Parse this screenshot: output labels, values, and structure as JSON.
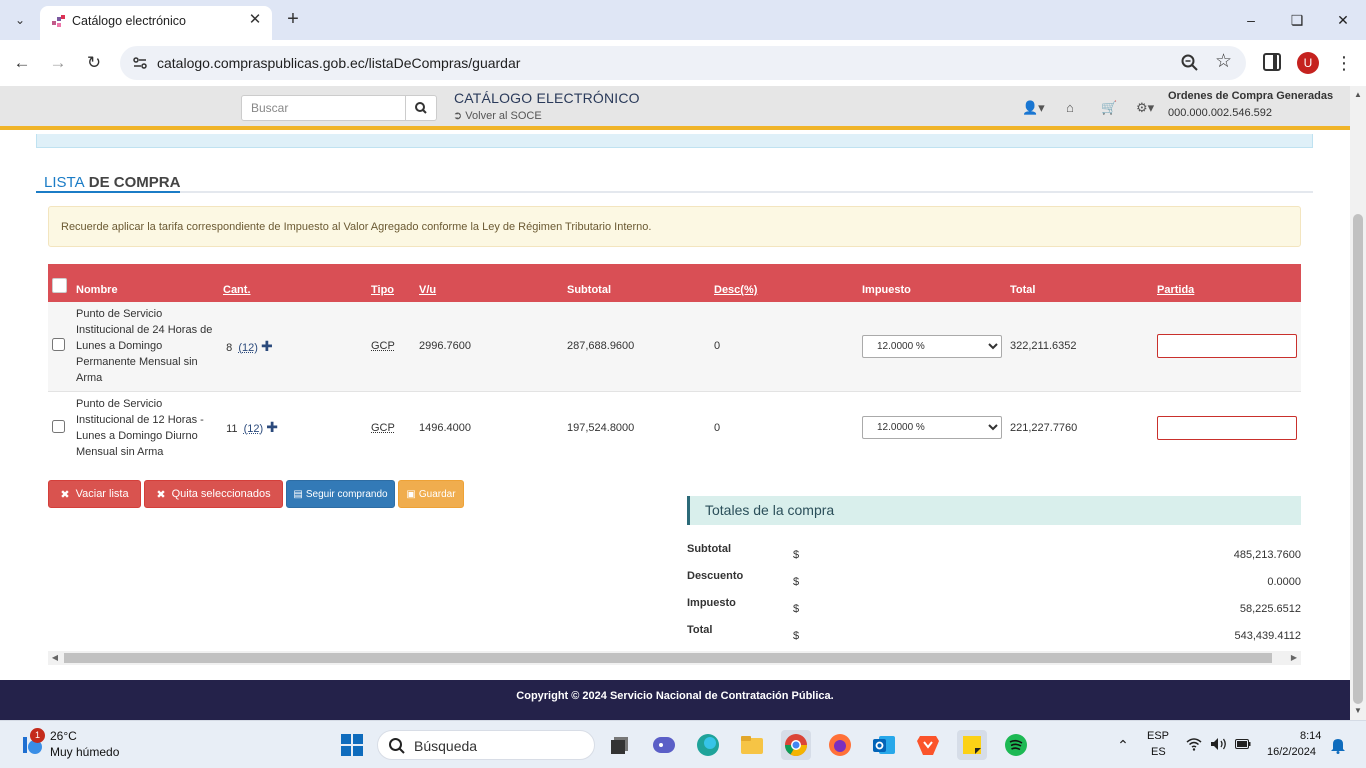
{
  "browser": {
    "tab_title": "Catálogo electrónico",
    "url": "catalogo.compraspublicas.gob.ec/listaDeCompras/guardar",
    "profile_initial": "U"
  },
  "header": {
    "search_placeholder": "Buscar",
    "brand_title": "CATÁLOGO ELECTRÓNICO",
    "back_link": "Volver al SOCE",
    "orders_title": "Ordenes de Compra Generadas",
    "orders_number": "000.000.002.546.592"
  },
  "section": {
    "title_highlight": "LISTA",
    "title_rest": " DE COMPRA"
  },
  "warning_text": "Recuerde aplicar la tarifa correspondiente de Impuesto al Valor Agregado conforme la Ley de Régimen Tributario Interno.",
  "table": {
    "columns": [
      "Nombre",
      "Cant.",
      "Tipo",
      "V/u",
      "Subtotal",
      "Desc(%)",
      "Impuesto",
      "Total",
      "Partida"
    ],
    "rows": [
      {
        "name": "Punto de Servicio Institucional de 24 Horas de Lunes a Domingo Permanente Mensual sin Arma",
        "qty": "8",
        "qty_link": "(12)",
        "type": "GCP",
        "unit_value": "2996.7600",
        "subtotal": "287,688.9600",
        "discount": "0",
        "tax": "12.0000 %",
        "total": "322,211.6352",
        "partida": ""
      },
      {
        "name": "Punto de Servicio Institucional de 12 Horas - Lunes a Domingo Diurno Mensual sin Arma",
        "qty": "11",
        "qty_link": "(12)",
        "type": "GCP",
        "unit_value": "1496.4000",
        "subtotal": "197,524.8000",
        "discount": "0",
        "tax": "12.0000 %",
        "total": "221,227.7760",
        "partida": ""
      }
    ]
  },
  "buttons": {
    "clear_list": "Vaciar lista",
    "remove_selected": "Quita seleccionados",
    "keep_shopping": "Seguir comprando",
    "save": "Guardar"
  },
  "totals": {
    "heading": "Totales de la compra",
    "currency": "$",
    "rows": [
      {
        "label": "Subtotal",
        "value": "485,213.7600"
      },
      {
        "label": "Descuento",
        "value": "0.0000"
      },
      {
        "label": "Impuesto",
        "value": "58,225.6512"
      },
      {
        "label": "Total",
        "value": "543,439.4112"
      }
    ]
  },
  "footer_text": "Copyright © 2024 Servicio Nacional de Contratación Pública.",
  "taskbar": {
    "weather_badge": "1",
    "temperature": "26°C",
    "weather_desc": "Muy húmedo",
    "search_placeholder": "Búsqueda",
    "lang_primary": "ESP",
    "lang_secondary": "ES",
    "time": "8:14",
    "date": "16/2/2024"
  },
  "colors": {
    "table_header": "#d94f55",
    "header_accent": "#f0b429",
    "footer_bg": "#24224a",
    "link_blue": "#1b7cc6"
  }
}
